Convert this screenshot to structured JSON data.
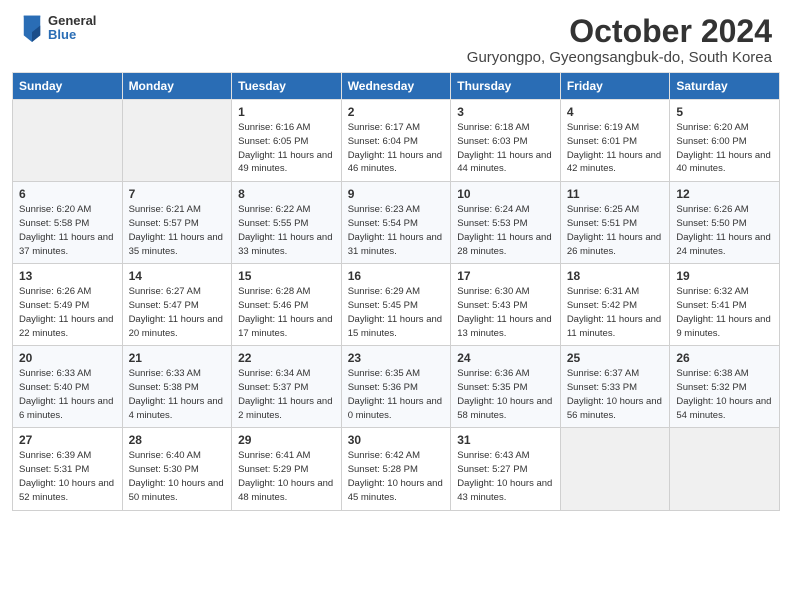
{
  "header": {
    "logo_general": "General",
    "logo_blue": "Blue",
    "title": "October 2024",
    "subtitle": "Guryongpo, Gyeongsangbuk-do, South Korea"
  },
  "days_of_week": [
    "Sunday",
    "Monday",
    "Tuesday",
    "Wednesday",
    "Thursday",
    "Friday",
    "Saturday"
  ],
  "weeks": [
    [
      {
        "day": "",
        "info": ""
      },
      {
        "day": "",
        "info": ""
      },
      {
        "day": "1",
        "info": "Sunrise: 6:16 AM\nSunset: 6:05 PM\nDaylight: 11 hours and 49 minutes."
      },
      {
        "day": "2",
        "info": "Sunrise: 6:17 AM\nSunset: 6:04 PM\nDaylight: 11 hours and 46 minutes."
      },
      {
        "day": "3",
        "info": "Sunrise: 6:18 AM\nSunset: 6:03 PM\nDaylight: 11 hours and 44 minutes."
      },
      {
        "day": "4",
        "info": "Sunrise: 6:19 AM\nSunset: 6:01 PM\nDaylight: 11 hours and 42 minutes."
      },
      {
        "day": "5",
        "info": "Sunrise: 6:20 AM\nSunset: 6:00 PM\nDaylight: 11 hours and 40 minutes."
      }
    ],
    [
      {
        "day": "6",
        "info": "Sunrise: 6:20 AM\nSunset: 5:58 PM\nDaylight: 11 hours and 37 minutes."
      },
      {
        "day": "7",
        "info": "Sunrise: 6:21 AM\nSunset: 5:57 PM\nDaylight: 11 hours and 35 minutes."
      },
      {
        "day": "8",
        "info": "Sunrise: 6:22 AM\nSunset: 5:55 PM\nDaylight: 11 hours and 33 minutes."
      },
      {
        "day": "9",
        "info": "Sunrise: 6:23 AM\nSunset: 5:54 PM\nDaylight: 11 hours and 31 minutes."
      },
      {
        "day": "10",
        "info": "Sunrise: 6:24 AM\nSunset: 5:53 PM\nDaylight: 11 hours and 28 minutes."
      },
      {
        "day": "11",
        "info": "Sunrise: 6:25 AM\nSunset: 5:51 PM\nDaylight: 11 hours and 26 minutes."
      },
      {
        "day": "12",
        "info": "Sunrise: 6:26 AM\nSunset: 5:50 PM\nDaylight: 11 hours and 24 minutes."
      }
    ],
    [
      {
        "day": "13",
        "info": "Sunrise: 6:26 AM\nSunset: 5:49 PM\nDaylight: 11 hours and 22 minutes."
      },
      {
        "day": "14",
        "info": "Sunrise: 6:27 AM\nSunset: 5:47 PM\nDaylight: 11 hours and 20 minutes."
      },
      {
        "day": "15",
        "info": "Sunrise: 6:28 AM\nSunset: 5:46 PM\nDaylight: 11 hours and 17 minutes."
      },
      {
        "day": "16",
        "info": "Sunrise: 6:29 AM\nSunset: 5:45 PM\nDaylight: 11 hours and 15 minutes."
      },
      {
        "day": "17",
        "info": "Sunrise: 6:30 AM\nSunset: 5:43 PM\nDaylight: 11 hours and 13 minutes."
      },
      {
        "day": "18",
        "info": "Sunrise: 6:31 AM\nSunset: 5:42 PM\nDaylight: 11 hours and 11 minutes."
      },
      {
        "day": "19",
        "info": "Sunrise: 6:32 AM\nSunset: 5:41 PM\nDaylight: 11 hours and 9 minutes."
      }
    ],
    [
      {
        "day": "20",
        "info": "Sunrise: 6:33 AM\nSunset: 5:40 PM\nDaylight: 11 hours and 6 minutes."
      },
      {
        "day": "21",
        "info": "Sunrise: 6:33 AM\nSunset: 5:38 PM\nDaylight: 11 hours and 4 minutes."
      },
      {
        "day": "22",
        "info": "Sunrise: 6:34 AM\nSunset: 5:37 PM\nDaylight: 11 hours and 2 minutes."
      },
      {
        "day": "23",
        "info": "Sunrise: 6:35 AM\nSunset: 5:36 PM\nDaylight: 11 hours and 0 minutes."
      },
      {
        "day": "24",
        "info": "Sunrise: 6:36 AM\nSunset: 5:35 PM\nDaylight: 10 hours and 58 minutes."
      },
      {
        "day": "25",
        "info": "Sunrise: 6:37 AM\nSunset: 5:33 PM\nDaylight: 10 hours and 56 minutes."
      },
      {
        "day": "26",
        "info": "Sunrise: 6:38 AM\nSunset: 5:32 PM\nDaylight: 10 hours and 54 minutes."
      }
    ],
    [
      {
        "day": "27",
        "info": "Sunrise: 6:39 AM\nSunset: 5:31 PM\nDaylight: 10 hours and 52 minutes."
      },
      {
        "day": "28",
        "info": "Sunrise: 6:40 AM\nSunset: 5:30 PM\nDaylight: 10 hours and 50 minutes."
      },
      {
        "day": "29",
        "info": "Sunrise: 6:41 AM\nSunset: 5:29 PM\nDaylight: 10 hours and 48 minutes."
      },
      {
        "day": "30",
        "info": "Sunrise: 6:42 AM\nSunset: 5:28 PM\nDaylight: 10 hours and 45 minutes."
      },
      {
        "day": "31",
        "info": "Sunrise: 6:43 AM\nSunset: 5:27 PM\nDaylight: 10 hours and 43 minutes."
      },
      {
        "day": "",
        "info": ""
      },
      {
        "day": "",
        "info": ""
      }
    ]
  ]
}
